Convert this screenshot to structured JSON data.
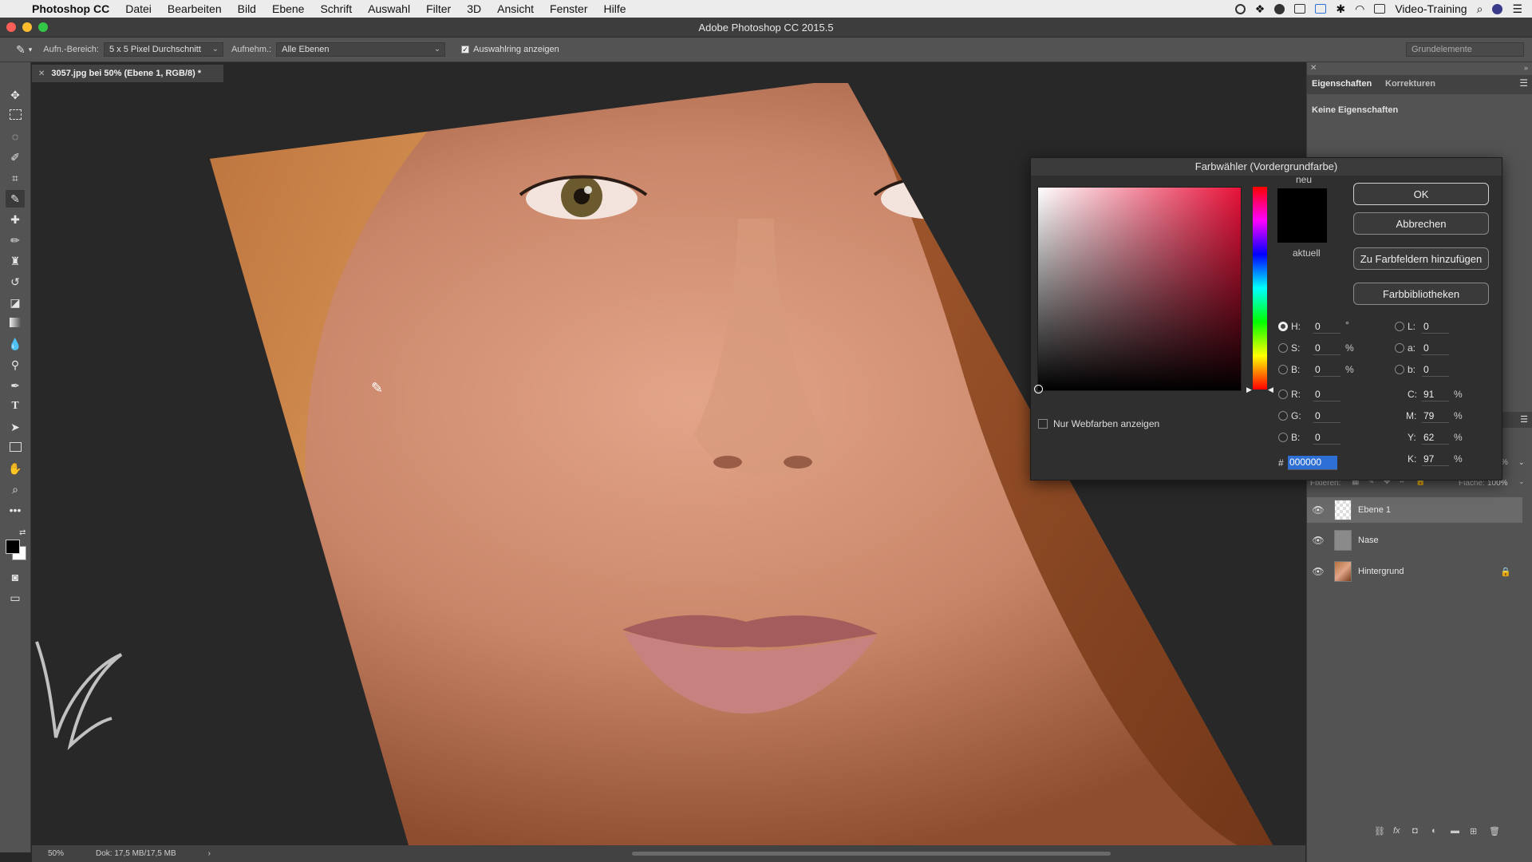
{
  "menubar": {
    "app": "Photoshop CC",
    "items": [
      "Datei",
      "Bearbeiten",
      "Bild",
      "Ebene",
      "Schrift",
      "Auswahl",
      "Filter",
      "3D",
      "Ansicht",
      "Fenster",
      "Hilfe"
    ],
    "user": "Video-Training"
  },
  "window": {
    "title": "Adobe Photoshop CC 2015.5"
  },
  "options": {
    "sample_size_label": "Aufn.-Bereich:",
    "sample_size_value": "5 x 5 Pixel Durchschnitt",
    "sample_label": "Aufnehm.:",
    "sample_value": "Alle Ebenen",
    "show_ring_label": "Auswahlring anzeigen",
    "workspace": "Grundelemente"
  },
  "document": {
    "tab": "3057.jpg bei 50% (Ebene 1, RGB/8) *",
    "zoom": "50%",
    "doc_size": "Dok: 17,5 MB/17,5 MB"
  },
  "properties": {
    "tab1": "Eigenschaften",
    "tab2": "Korrekturen",
    "empty": "Keine Eigenschaften"
  },
  "dialog": {
    "title": "Farbwähler (Vordergrundfarbe)",
    "ok": "OK",
    "cancel": "Abbrechen",
    "add_swatch": "Zu Farbfeldern hinzufügen",
    "libraries": "Farbbibliotheken",
    "new_label": "neu",
    "current_label": "aktuell",
    "web_only": "Nur Webfarben anzeigen",
    "hex_label": "#",
    "hex": "000000",
    "fields": {
      "H": {
        "label": "H:",
        "value": "0",
        "unit": "°"
      },
      "S": {
        "label": "S:",
        "value": "0",
        "unit": "%"
      },
      "Bv": {
        "label": "B:",
        "value": "0",
        "unit": "%"
      },
      "R": {
        "label": "R:",
        "value": "0"
      },
      "G": {
        "label": "G:",
        "value": "0"
      },
      "Bb": {
        "label": "B:",
        "value": "0"
      },
      "L": {
        "label": "L:",
        "value": "0"
      },
      "a": {
        "label": "a:",
        "value": "0"
      },
      "b": {
        "label": "b:",
        "value": "0"
      },
      "C": {
        "label": "C:",
        "value": "91",
        "unit": "%"
      },
      "M": {
        "label": "M:",
        "value": "79",
        "unit": "%"
      },
      "Y": {
        "label": "Y:",
        "value": "62",
        "unit": "%"
      },
      "K": {
        "label": "K:",
        "value": "97",
        "unit": "%"
      }
    }
  },
  "layers": {
    "lock_label": "Fixieren:",
    "fill_label": "Fläche:",
    "fill_value": "100%",
    "opacity_partial": "%",
    "items": [
      "Ebene 1",
      "Nase",
      "Hintergrund"
    ]
  },
  "colors": {
    "accent": "#2e6fd6",
    "hue": "#e8123a"
  }
}
